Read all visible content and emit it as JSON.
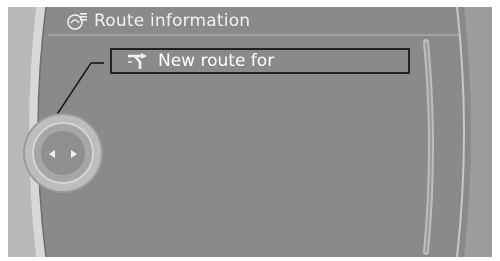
{
  "header": {
    "title": "Route information",
    "icon": "route-settings-icon"
  },
  "menu": {
    "items": [
      {
        "label": "New route for",
        "icon": "route-fork-icon",
        "selected": true
      }
    ]
  },
  "controller": {
    "icon_left": "arrow-left-icon",
    "icon_right": "arrow-right-icon"
  },
  "colors": {
    "background": "#8a8a8a",
    "text": "#ffffff",
    "highlight_border": "#222222"
  }
}
